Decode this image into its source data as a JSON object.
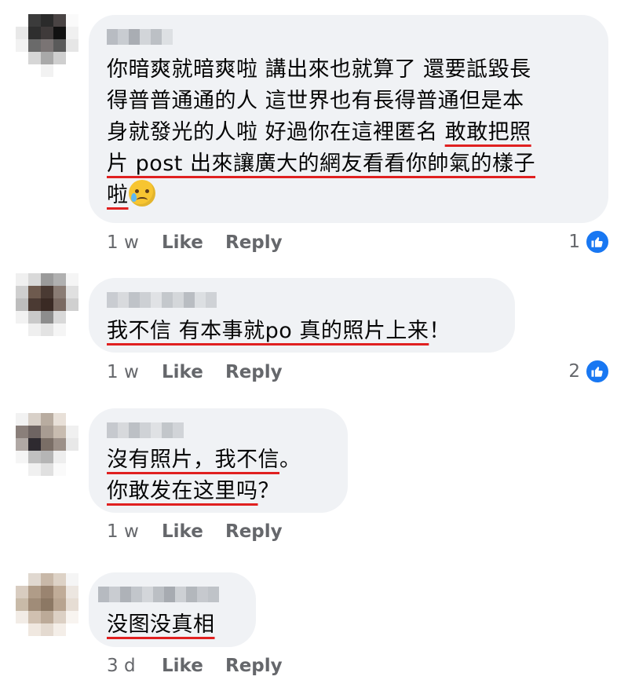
{
  "comments": [
    {
      "avatar_colors": [
        "#ffffff",
        "#3b3b3b",
        "#2b2b2b",
        "#4a4444",
        "#fafafa",
        "#e8e8e8",
        "#2e2e2e",
        "#3f3a3a",
        "#111111",
        "#f0f0f0",
        "#f2f2f2",
        "#6a6a6a",
        "#7a7474",
        "#5a5a5a",
        "#e6e6e6",
        "#ffffff",
        "#d6d6d6",
        "#a9a9a9",
        "#cfcfcf",
        "#ffffff",
        "#ffffff",
        "#ffffff",
        "#f2f2f2",
        "#ffffff",
        "#ffffff"
      ],
      "name_colors": [
        "#b8bcc2",
        "#c8ccd1",
        "#a9adb3",
        "#d2d5d9",
        "#bcc0c5",
        "#dde0e3"
      ],
      "lines": [
        [
          {
            "t": "你暗爽就暗爽啦 講出來也就算了 還要詆毀長",
            "u": false
          }
        ],
        [
          {
            "t": "得普普通通的人 這世界也有長得普通但是本",
            "u": false
          }
        ],
        [
          {
            "t": "身就發光的人啦 好過你在這裡匿名 ",
            "u": false
          },
          {
            "t": "敢敢把照",
            "u": true
          }
        ],
        [
          {
            "t": "片 post 出來讓廣大的網友看看你帥氣的樣子",
            "u": true
          }
        ],
        [
          {
            "t": "啦",
            "u": true
          },
          {
            "t": "emoji",
            "u": false
          }
        ]
      ],
      "time": "1 w",
      "like": "Like",
      "reply": "Reply",
      "reactions": "1"
    },
    {
      "avatar_colors": [
        "#f0f0f0",
        "#d9d9d9",
        "#9a9a9a",
        "#b0b0b0",
        "#f5f5f5",
        "#cfcfcf",
        "#6e5a4e",
        "#4a3a33",
        "#8a7c74",
        "#e0e0e0",
        "#bdbdbd",
        "#4b3a33",
        "#3a2a24",
        "#7a6a62",
        "#d0d0d0",
        "#f2f2f2",
        "#c9c9c9",
        "#8d8d8d",
        "#d9d9d9",
        "#ffffff",
        "#ffffff",
        "#efefef",
        "#e3e3e3",
        "#f5f5f5",
        "#ffffff"
      ],
      "name_colors": [
        "#c9ccd1",
        "#d8dadd",
        "#bfc3c8",
        "#cdd0d4",
        "#e0e2e5",
        "#c4c8cc",
        "#d4d7da",
        "#b9bdc2",
        "#dcdfe2",
        "#cfd2d6"
      ],
      "lines": [
        [
          {
            "t": "我不信 有本事就po 真的照片上来",
            "u": true
          },
          {
            "t": "！",
            "u": false
          }
        ]
      ],
      "time": "1 w",
      "like": "Like",
      "reply": "Reply",
      "reactions": "2"
    },
    {
      "avatar_colors": [
        "#f2f2f2",
        "#d8d0c8",
        "#b8aca0",
        "#e8e0d8",
        "#ffffff",
        "#8a7f7a",
        "#6e6462",
        "#a89c92",
        "#c8bcb0",
        "#f0f0f0",
        "#b0a8a4",
        "#2e2a30",
        "#7a6e66",
        "#9c9088",
        "#e8e8e8",
        "#f5f5f5",
        "#c0c0c0",
        "#b5b5b5",
        "#eeeeee",
        "#ffffff",
        "#ffffff",
        "#f0f0f0",
        "#e0e0e0",
        "#fafafa",
        "#ffffff"
      ],
      "name_colors": [
        "#c6c9ce",
        "#d7d9dc",
        "#bcc0c5",
        "#cfd2d6",
        "#dfe1e4",
        "#c2c6ca",
        "#d1d4d8"
      ],
      "lines": [
        [
          {
            "t": "沒有照片，我不信",
            "u": true
          },
          {
            "t": "。",
            "u": false
          }
        ],
        [
          {
            "t": "你敢发在这里吗",
            "u": true
          },
          {
            "t": "？",
            "u": false
          }
        ]
      ],
      "time": "1 w",
      "like": "Like",
      "reply": "Reply",
      "reactions": ""
    },
    {
      "avatar_colors": [
        "#ffffff",
        "#e0d8d0",
        "#c8b8a8",
        "#ddd2c6",
        "#f5f5f5",
        "#d8ccc0",
        "#b09c88",
        "#9a8470",
        "#c0ac98",
        "#ece6e0",
        "#c8baa8",
        "#a08c78",
        "#8c7864",
        "#b8a490",
        "#e6ddd4",
        "#f2ece6",
        "#d0c0b0",
        "#bcaa98",
        "#dcd0c4",
        "#f8f4f0",
        "#ffffff",
        "#f0e8e0",
        "#e4dad0",
        "#f4eee8",
        "#ffffff"
      ],
      "name_colors": [
        "#b6bac0",
        "#c9ccd1",
        "#aeb2b8",
        "#c2c6cb",
        "#d3d6da",
        "#bbbfc4",
        "#a7abb1",
        "#cdd0d4",
        "#b3b7bc",
        "#c6c9ce",
        "#bfc3c8"
      ],
      "lines": [
        [
          {
            "t": "没图没真相",
            "u": true
          }
        ]
      ],
      "time": "3 d",
      "like": "Like",
      "reply": "Reply",
      "reactions": ""
    }
  ],
  "icons": {
    "reaction": "like-thumb-icon",
    "emoji": "crying-smile-emoji-icon"
  },
  "colors": {
    "bubble": "#f0f2f5",
    "meta": "#65676b",
    "underline": "#e02020",
    "like_blue": "#1877f2"
  }
}
